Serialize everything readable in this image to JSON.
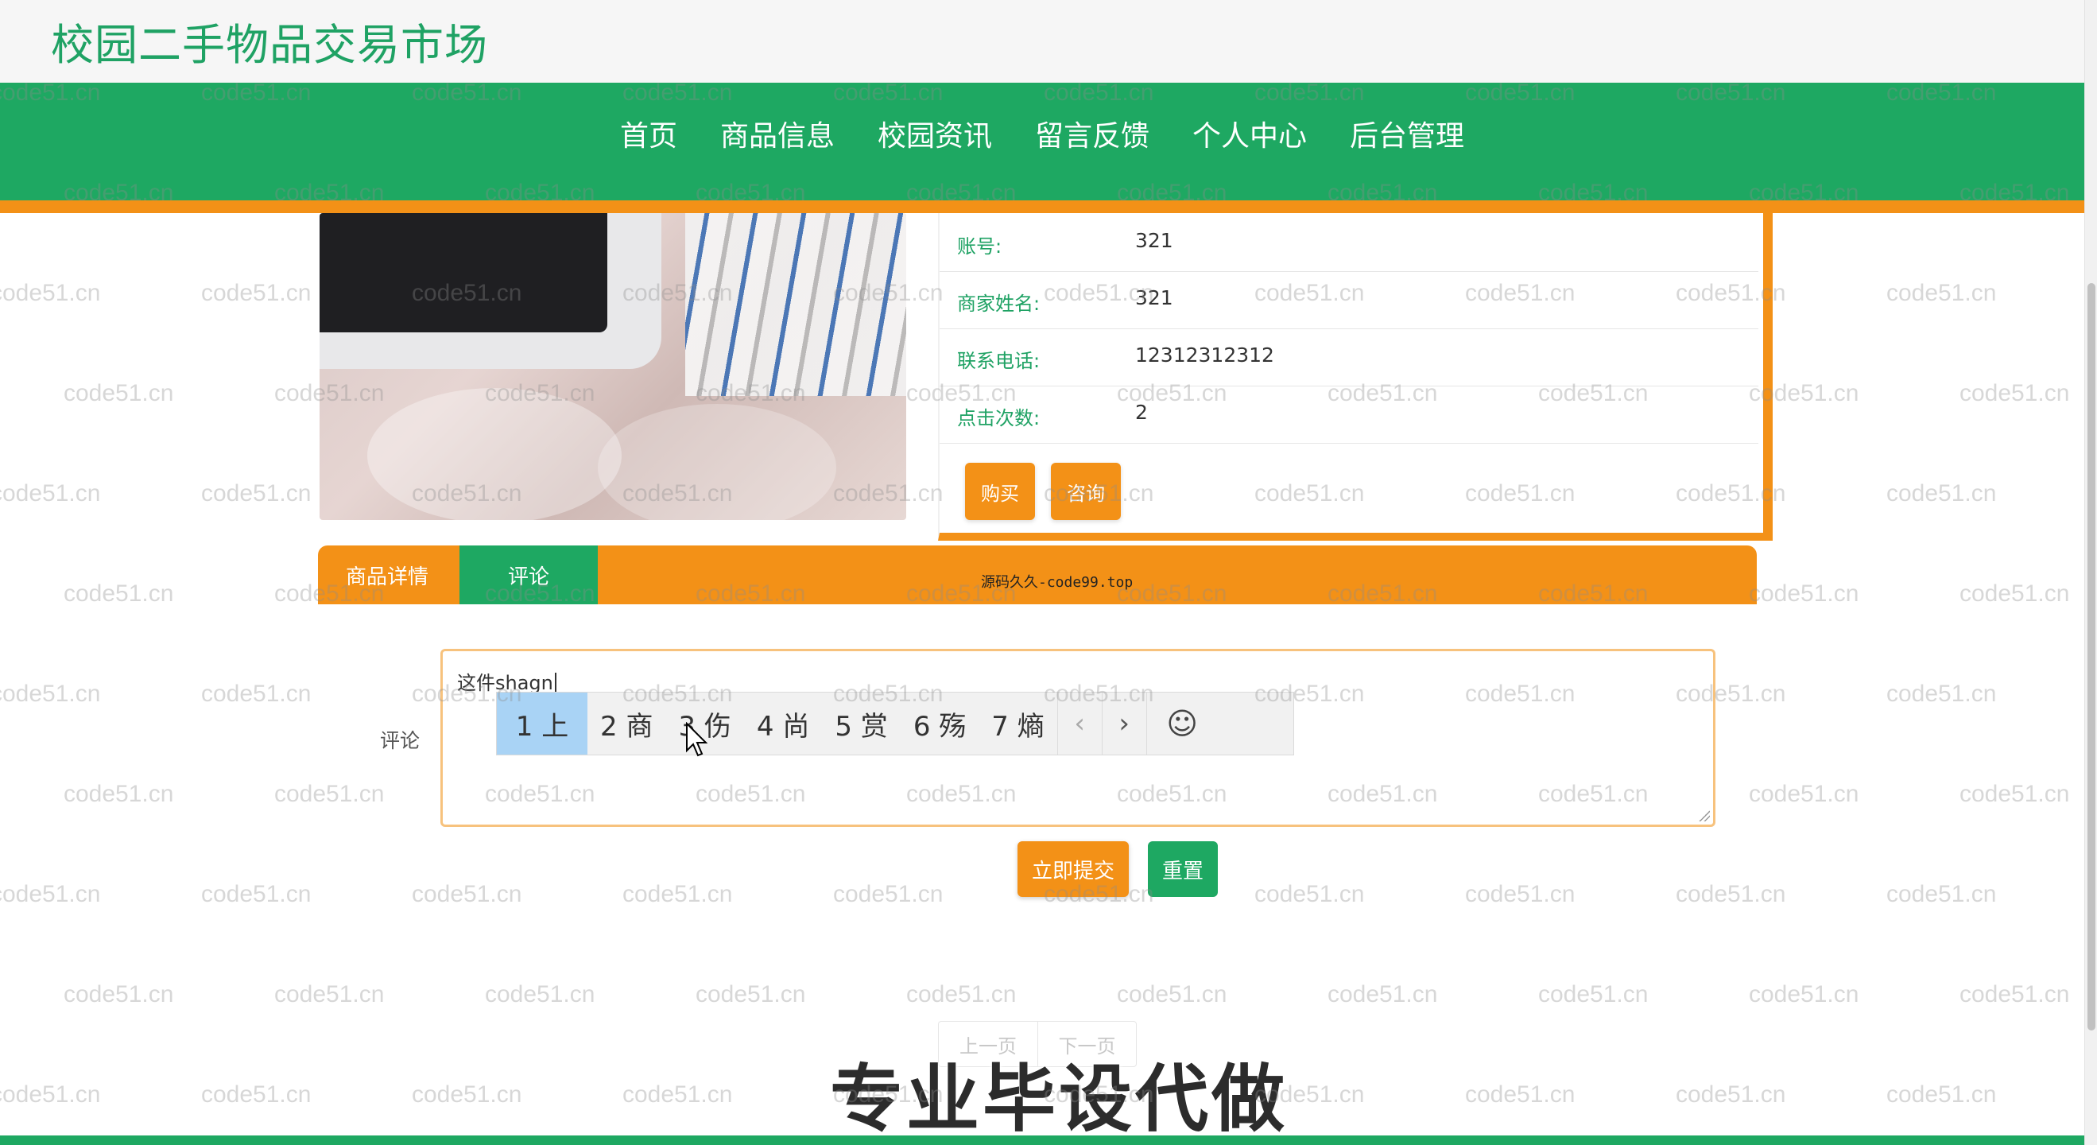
{
  "header": {
    "site_title": "校园二手物品交易市场"
  },
  "nav": {
    "items": [
      "首页",
      "商品信息",
      "校园资讯",
      "留言反馈",
      "个人中心",
      "后台管理"
    ]
  },
  "product": {
    "fields": [
      {
        "label": "账号:",
        "value": "321"
      },
      {
        "label": "商家姓名:",
        "value": "321"
      },
      {
        "label": "联系电话:",
        "value": "12312312312"
      },
      {
        "label": "点击次数:",
        "value": "2"
      }
    ],
    "buy_label": "购买",
    "consult_label": "咨询"
  },
  "tabs": {
    "details": "商品详情",
    "comments": "评论",
    "note": "源码久久-code99.top"
  },
  "comment": {
    "label": "评论",
    "typed_text": "这件shagn",
    "submit_label": "立即提交",
    "reset_label": "重置"
  },
  "ime": {
    "candidates": [
      "1 上",
      "2 商",
      "3 伤",
      "4 尚",
      "5 赏",
      "6 殇",
      "7 熵"
    ],
    "prev_icon": "‹",
    "next_icon": "›",
    "emoji_icon": "☺"
  },
  "pager": {
    "prev": "上一页",
    "next": "下一页"
  },
  "overlay": {
    "promo_text": "专业毕设代做",
    "watermark_text": "code51.cn"
  },
  "colors": {
    "brand_green": "#1ea862",
    "accent_orange": "#f39117"
  }
}
